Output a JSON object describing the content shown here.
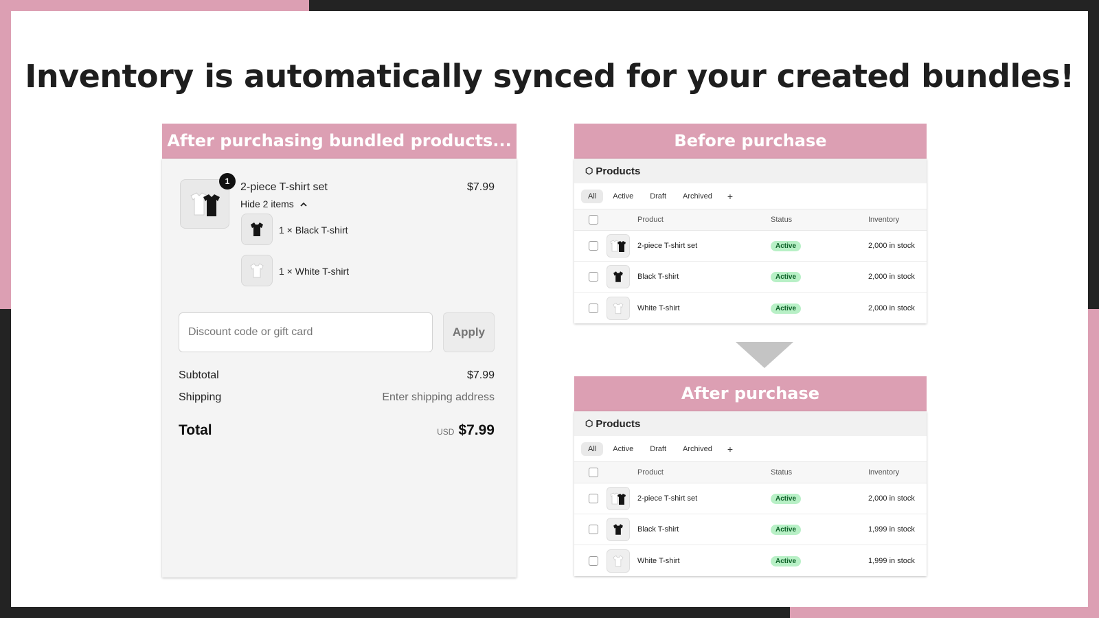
{
  "headline": "Inventory is automatically synced for your created bundles!",
  "colors": {
    "accent_pink": "#dc9fb3",
    "frame_dark": "#232323",
    "status_green_bg": "#b8f0c6",
    "status_green_text": "#0b5f26"
  },
  "checkout": {
    "header": "After purchasing bundled products...",
    "bundle": {
      "name": "2-piece T-shirt set",
      "price": "$7.99",
      "quantity_badge": "1",
      "toggle_label": "Hide 2 items",
      "toggle_icon": "chevron-up-icon"
    },
    "sub_items": [
      {
        "label": "1 × Black T-shirt",
        "icon": "black-tshirt-icon"
      },
      {
        "label": "1 × White T-shirt",
        "icon": "white-tshirt-icon"
      }
    ],
    "discount_placeholder": "Discount code or gift card",
    "apply_label": "Apply",
    "subtotal_label": "Subtotal",
    "subtotal_value": "$7.99",
    "shipping_label": "Shipping",
    "shipping_value": "Enter shipping address",
    "total_label": "Total",
    "total_currency": "USD",
    "total_value": "$7.99"
  },
  "before": {
    "header": "Before purchase",
    "title": "Products",
    "title_icon": "tag-icon",
    "tabs": [
      "All",
      "Active",
      "Draft",
      "Archived"
    ],
    "tab_add": "+",
    "columns": {
      "product": "Product",
      "status": "Status",
      "inventory": "Inventory"
    },
    "rows": [
      {
        "product": "2-piece T-shirt set",
        "status": "Active",
        "inventory": "2,000 in stock",
        "thumb": "tshirt-set-icon"
      },
      {
        "product": "Black T-shirt",
        "status": "Active",
        "inventory": "2,000 in stock",
        "thumb": "black-tshirt-icon"
      },
      {
        "product": "White T-shirt",
        "status": "Active",
        "inventory": "2,000 in stock",
        "thumb": "white-tshirt-icon"
      }
    ]
  },
  "after": {
    "header": "After purchase",
    "title": "Products",
    "title_icon": "tag-icon",
    "tabs": [
      "All",
      "Active",
      "Draft",
      "Archived"
    ],
    "tab_add": "+",
    "columns": {
      "product": "Product",
      "status": "Status",
      "inventory": "Inventory"
    },
    "rows": [
      {
        "product": "2-piece T-shirt set",
        "status": "Active",
        "inventory": "2,000 in stock",
        "thumb": "tshirt-set-icon"
      },
      {
        "product": "Black T-shirt",
        "status": "Active",
        "inventory": "1,999 in stock",
        "thumb": "black-tshirt-icon"
      },
      {
        "product": "White T-shirt",
        "status": "Active",
        "inventory": "1,999 in stock",
        "thumb": "white-tshirt-icon"
      }
    ]
  }
}
